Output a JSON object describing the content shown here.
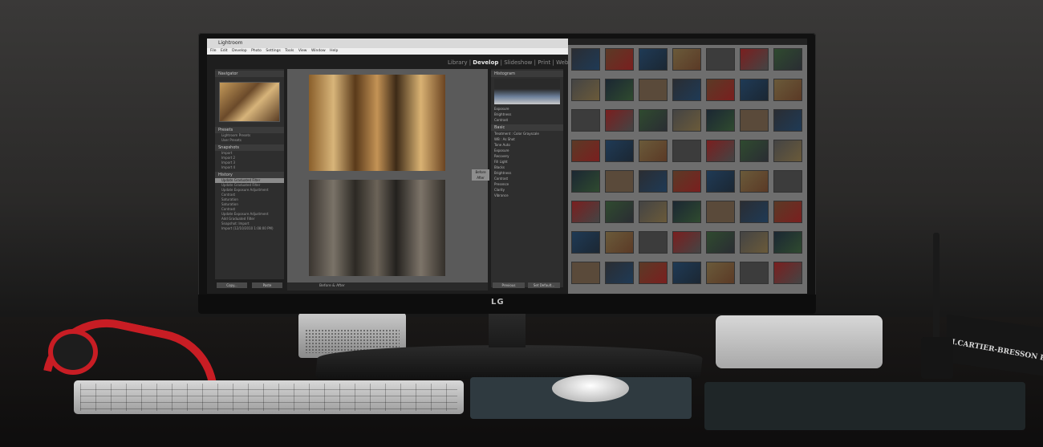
{
  "monitor": {
    "brand": "LG"
  },
  "lightroom": {
    "window_title": "Lightroom",
    "menu": [
      "File",
      "Edit",
      "Develop",
      "Photo",
      "Settings",
      "Tools",
      "View",
      "Window",
      "Help"
    ],
    "modules": {
      "library": "Library",
      "develop": "Develop",
      "slideshow": "Slideshow",
      "print": "Print",
      "web": "Web"
    },
    "left_panels": {
      "navigator": "Navigator",
      "presets": "Presets",
      "presets_items": [
        "Lightroom Presets",
        "User Presets"
      ],
      "snapshots": "Snapshots",
      "snapshots_items": [
        "Import",
        "Import 2",
        "Import 3",
        "Import 4"
      ],
      "history": "History",
      "history_items": [
        "Update Graduated Filter",
        "Update Graduated Filter",
        "Update Exposure Adjustment",
        "Contrast",
        "Saturation",
        "Saturation",
        "Contrast",
        "Update Exposure Adjustment",
        "Add Graduated Filter",
        "Snapshot: Import",
        "Import (12/10/2010 1:08:00 PM)"
      ],
      "copy_button": "Copy...",
      "paste_button": "Paste"
    },
    "center": {
      "before_label": "Before",
      "after_label": "After",
      "view_mode": "Before & After"
    },
    "right_panels": {
      "histogram": "Histogram",
      "basic": "Basic",
      "treatment": "Treatment :",
      "color": "Color",
      "bw": "Grayscale",
      "wb": "WB :",
      "wb_value": "As Shot",
      "tone": "Tone",
      "auto": "Auto",
      "exposure": "Exposure",
      "recovery": "Recovery",
      "fill_light": "Fill Light",
      "blacks": "Blacks",
      "brightness": "Brightness",
      "contrast": "Contrast",
      "presence": "Presence",
      "clarity": "Clarity",
      "vibrance": "Vibrance",
      "previous_button": "Previous",
      "set_default_button": "Set Default..."
    }
  },
  "book": {
    "spine_text": "H.CARTIER-BRESSON PHOTO"
  }
}
